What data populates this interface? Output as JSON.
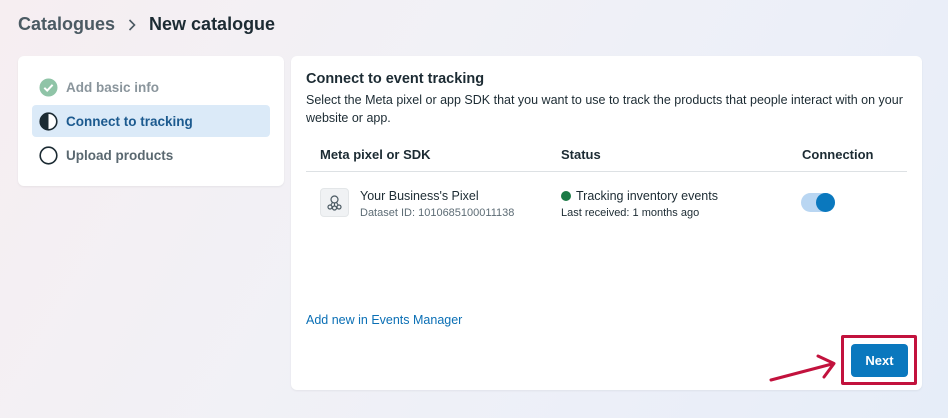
{
  "breadcrumb": {
    "parent": "Catalogues",
    "separator_icon": "chevron-right-icon",
    "current": "New catalogue"
  },
  "steps": [
    {
      "label": "Add basic info",
      "state": "done",
      "icon": "check-circle-icon"
    },
    {
      "label": "Connect to tracking",
      "state": "active",
      "icon": "half-circle-icon"
    },
    {
      "label": "Upload products",
      "state": "todo",
      "icon": "empty-circle-icon"
    }
  ],
  "main": {
    "title": "Connect to event tracking",
    "description": "Select the Meta pixel or app SDK that you want to use to track the products that people interact with on your website or app.",
    "columns": {
      "pixel": "Meta pixel or SDK",
      "status": "Status",
      "connection": "Connection"
    },
    "row": {
      "icon": "pixel-icon",
      "name": "Your Business's Pixel",
      "dataset_label": "Dataset ID:",
      "dataset_id": "1010685100011138",
      "status": "Tracking inventory events",
      "status_color": "#1a7a45",
      "last_received_label": "Last received:",
      "last_received_value": "1 months ago",
      "connected": true
    },
    "link": "Add new in Events Manager",
    "next_label": "Next"
  },
  "colors": {
    "accent": "#0a78be",
    "highlight": "#c2123d",
    "active_step_bg": "#dbeaf8"
  }
}
